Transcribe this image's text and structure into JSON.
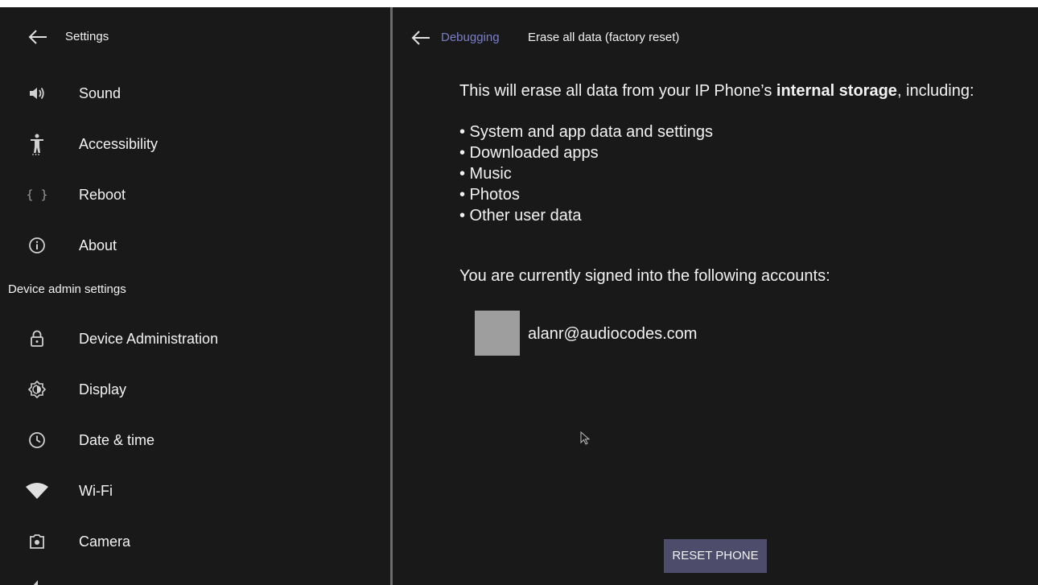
{
  "colors": {
    "background": "#1a1919",
    "divider": "#6b6b6b",
    "text": "#f2f2f2",
    "breadcrumb_link": "#7a7fc7",
    "button_bg": "#4d4c6b",
    "avatar": "#9e9e9e"
  },
  "settings_panel": {
    "back_icon": "arrow-left-icon",
    "title": "Settings",
    "items": [
      {
        "label": "Sound",
        "icon": "volume-icon"
      },
      {
        "label": "Accessibility",
        "icon": "accessibility-icon"
      },
      {
        "label": "Reboot",
        "icon": "braces-icon"
      },
      {
        "label": "About",
        "icon": "info-icon"
      }
    ],
    "section_header": "Device admin settings",
    "admin_items": [
      {
        "label": "Device Administration",
        "icon": "lock-icon"
      },
      {
        "label": "Display",
        "icon": "brightness-icon"
      },
      {
        "label": "Date & time",
        "icon": "clock-icon"
      },
      {
        "label": "Wi-Fi",
        "icon": "wifi-icon"
      },
      {
        "label": "Camera",
        "icon": "camera-icon"
      }
    ]
  },
  "detail_panel": {
    "back_icon": "arrow-left-icon",
    "breadcrumb": "Debugging",
    "title": "Erase all data (factory reset)",
    "intro_prefix": "This will erase all data from your IP Phone’s ",
    "intro_bold": "internal storage",
    "intro_suffix": ", including:",
    "bullets": [
      "• System and app data and settings",
      "• Downloaded apps",
      "• Music",
      "• Photos",
      "• Other user data"
    ],
    "accounts_heading": "You are currently signed into the following accounts:",
    "account_email": "alanr@audiocodes.com",
    "reset_button": "RESET PHONE"
  }
}
